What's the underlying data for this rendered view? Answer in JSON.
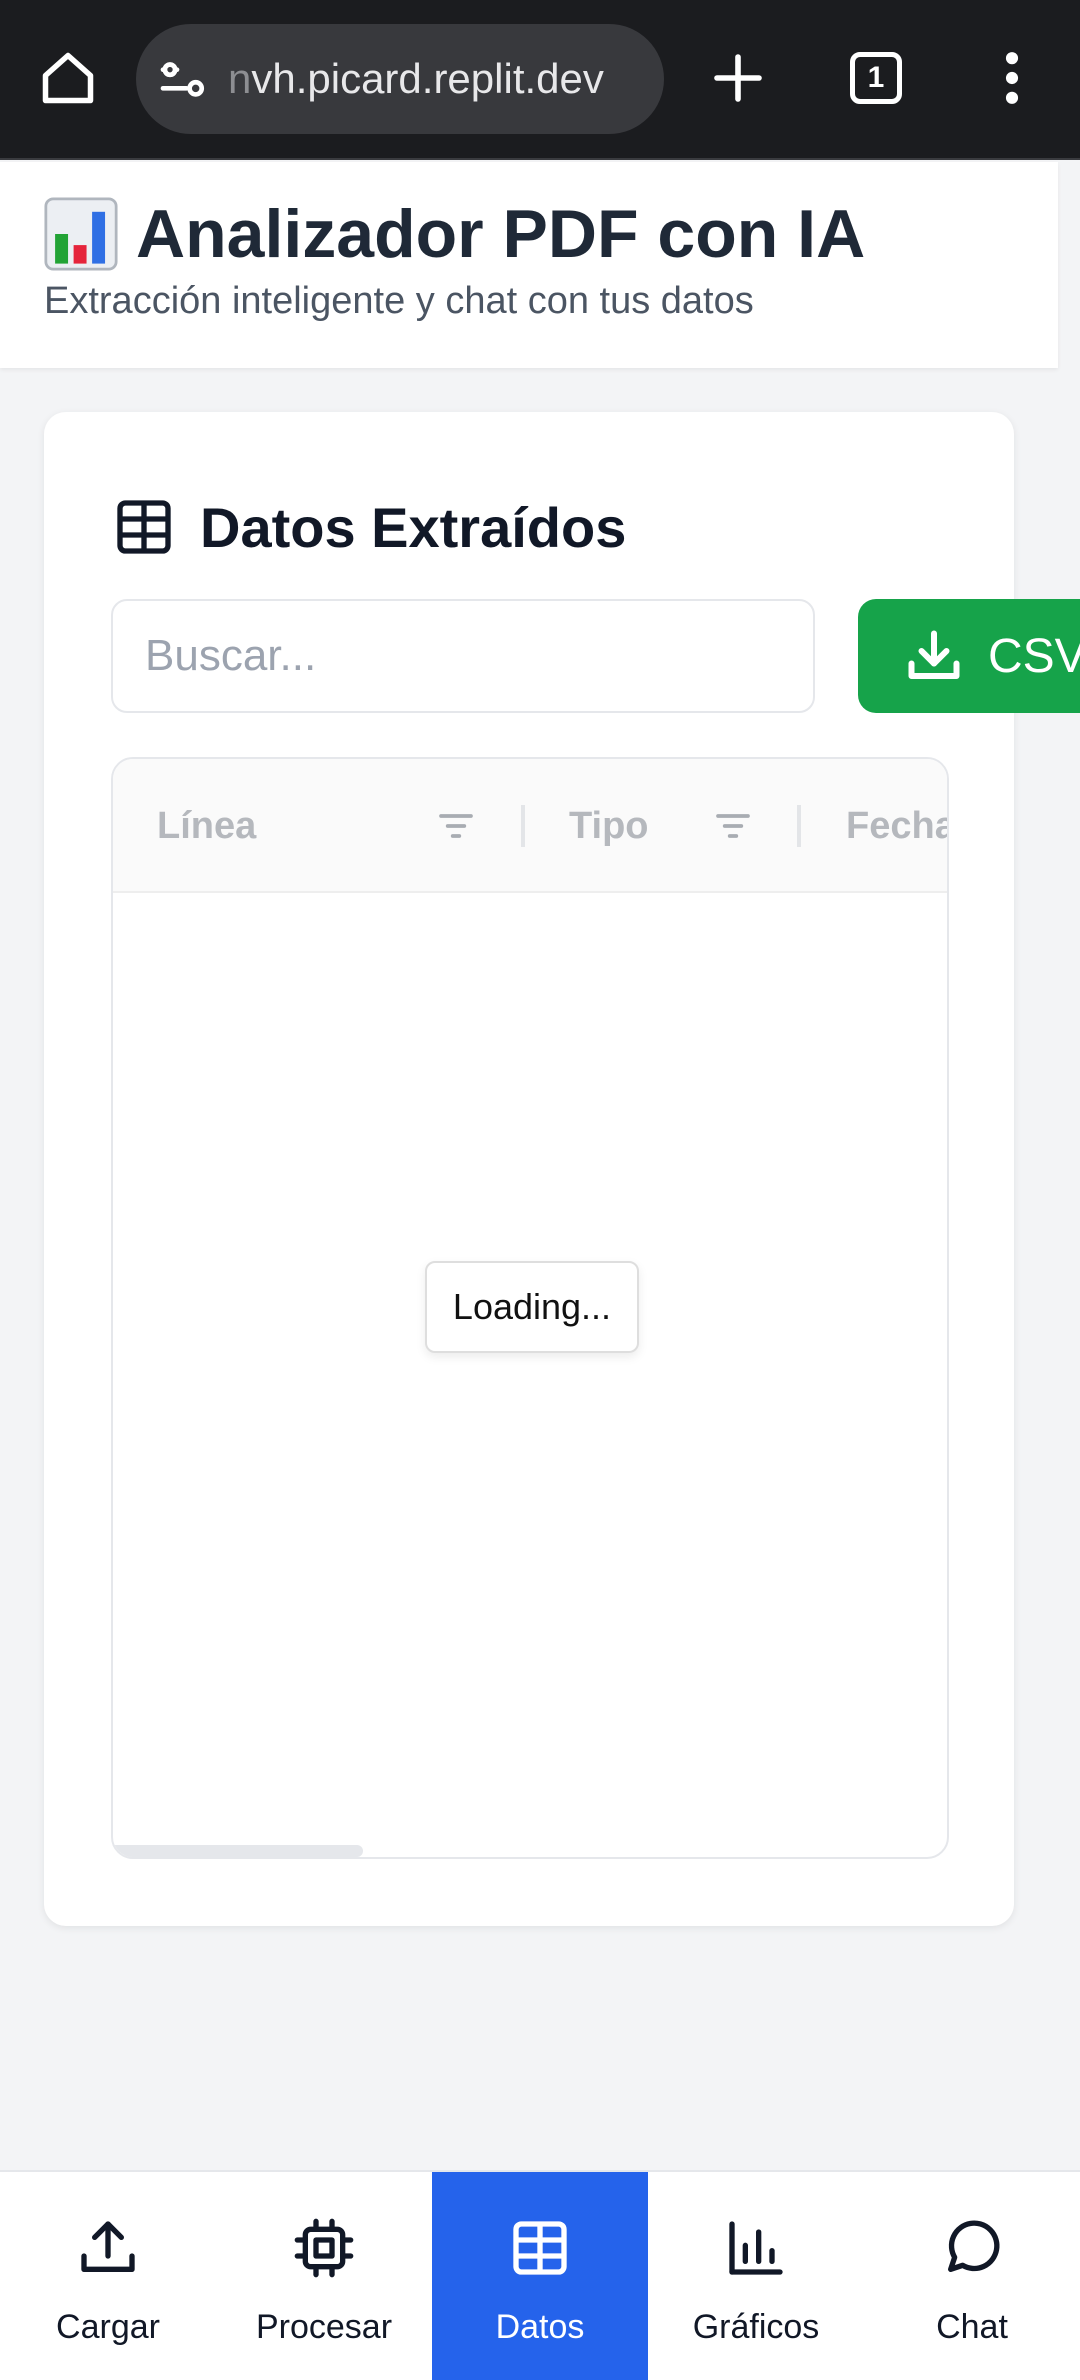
{
  "browser": {
    "url_faded": "n",
    "url": "vh.picard.replit.dev",
    "tab_count": "1"
  },
  "header": {
    "title": "Analizador PDF con IA",
    "subtitle": "Extracción inteligente y chat con tus datos",
    "title_icon": "bar-chart-emoji"
  },
  "data_card": {
    "title": "Datos Extraídos",
    "title_icon": "table-icon",
    "search_placeholder": "Buscar...",
    "export_label": "CSV",
    "columns": [
      "Línea",
      "Tipo",
      "Fecha"
    ],
    "loading_text": "Loading..."
  },
  "bottom_nav": {
    "items": [
      {
        "label": "Cargar",
        "icon": "upload-icon"
      },
      {
        "label": "Procesar",
        "icon": "cpu-icon"
      },
      {
        "label": "Datos",
        "icon": "table-icon"
      },
      {
        "label": "Gráficos",
        "icon": "bar-chart-icon"
      },
      {
        "label": "Chat",
        "icon": "chat-bubble-icon"
      }
    ],
    "active": "Datos"
  },
  "colors": {
    "primary": "#2563eb",
    "export_green": "#16a34a",
    "browser_bar": "#1b1c1f",
    "page_bg": "#f3f4f6"
  }
}
